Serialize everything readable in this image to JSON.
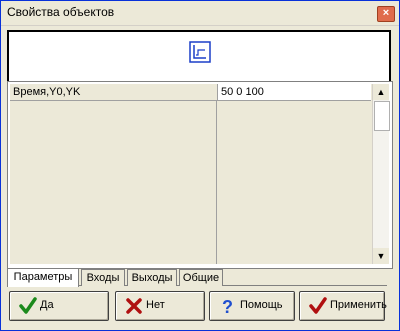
{
  "window": {
    "title": "Свойства объектов"
  },
  "grid": {
    "rows": [
      {
        "name": "Время,Y0,YK",
        "value": "50 0 100"
      }
    ]
  },
  "tabs": [
    {
      "label": "Параметры",
      "active": true
    },
    {
      "label": "Входы",
      "active": false
    },
    {
      "label": "Выходы",
      "active": false
    },
    {
      "label": "Общие",
      "active": false
    }
  ],
  "buttons": {
    "ok": "Да",
    "cancel": "Нет",
    "help": "Помощь",
    "apply": "Применить"
  },
  "colors": {
    "accent": "#1b3ec8",
    "ok_icon": "#1c8a1c",
    "cancel_icon": "#b01010",
    "help_icon": "#1f4fcf"
  }
}
